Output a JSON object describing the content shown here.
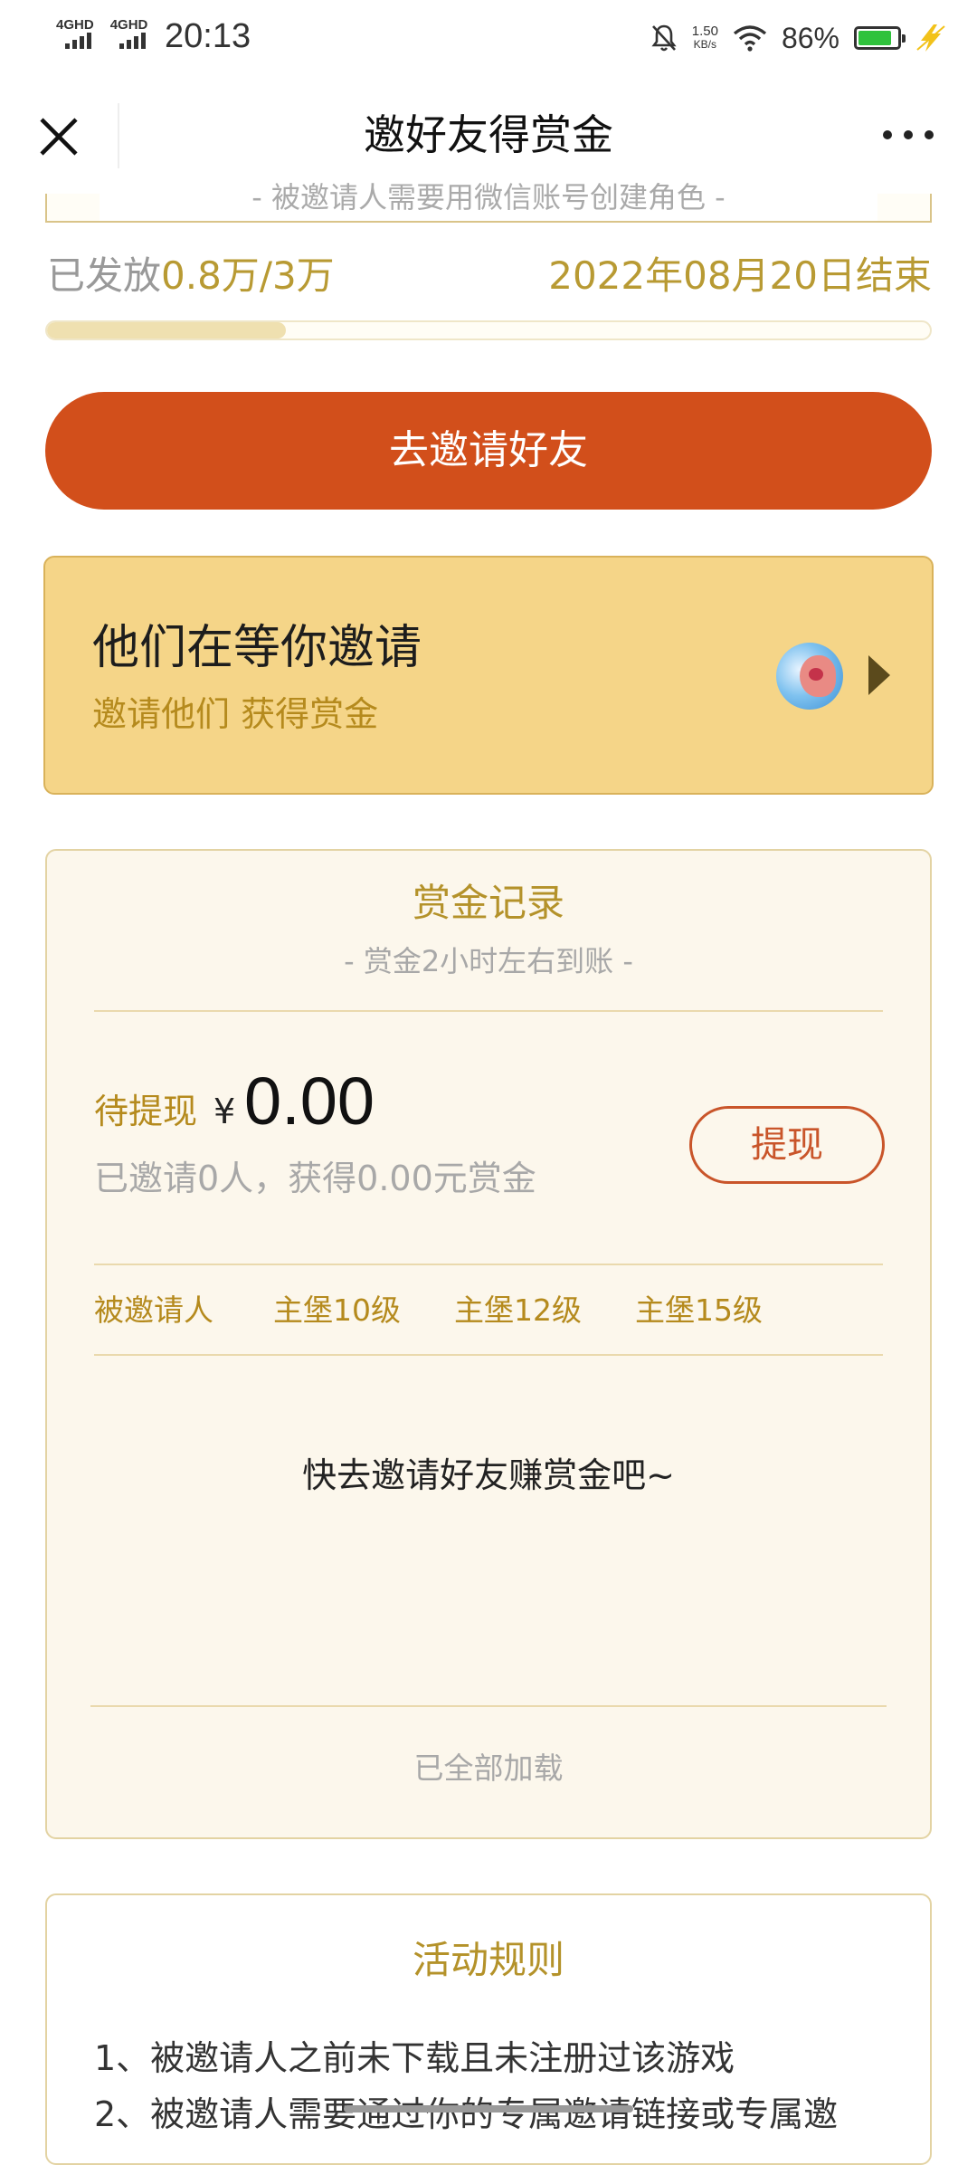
{
  "status_bar": {
    "signal_1": "4GHD",
    "signal_2": "4GHD",
    "time": "20:13",
    "net_speed_value": "1.50",
    "net_speed_unit": "KB/s",
    "battery_percent": "86%",
    "battery_level": 0.86,
    "icons": [
      "signal-icon",
      "mute-icon",
      "wifi-icon",
      "battery-icon",
      "charging-icon"
    ]
  },
  "nav": {
    "title": "邀好友得赏金",
    "close_icon": "close-icon",
    "more_icon": "more-icon"
  },
  "top_card": {
    "note": "- 被邀请人需要用微信账号创建角色 -"
  },
  "progress": {
    "issued_prefix": "已发放",
    "issued_amount": "0.8万",
    "issued_total": "/3万",
    "end_date": "2022年08月20日结束",
    "fraction": 0.27
  },
  "invite_button": {
    "label": "去邀请好友"
  },
  "waiting": {
    "title": "他们在等你邀请",
    "subtitle": "邀请他们 获得赏金",
    "arrow_icon": "triangle-right-icon"
  },
  "record": {
    "title": "赏金记录",
    "subtitle": "- 赏金2小时左右到账 -",
    "pending_label": "待提现",
    "currency": "¥",
    "amount": "0.00",
    "invited_summary": "已邀请0人，获得0.00元赏金",
    "withdraw_label": "提现",
    "columns": [
      "被邀请人",
      "主堡10级",
      "主堡12级",
      "主堡15级"
    ],
    "empty_text": "快去邀请好友赚赏金吧~",
    "loaded_text": "已全部加载"
  },
  "rules": {
    "title": "活动规则",
    "items": [
      "1、被邀请人之前未下载且未注册过该游戏",
      "2、被邀请人需要通过你的专属邀请链接或专属邀"
    ]
  },
  "colors": {
    "accent_orange": "#d24f1b",
    "gold": "#b89a33",
    "panel_yellow": "#f5d588",
    "card_cream": "#fcf7ec"
  }
}
